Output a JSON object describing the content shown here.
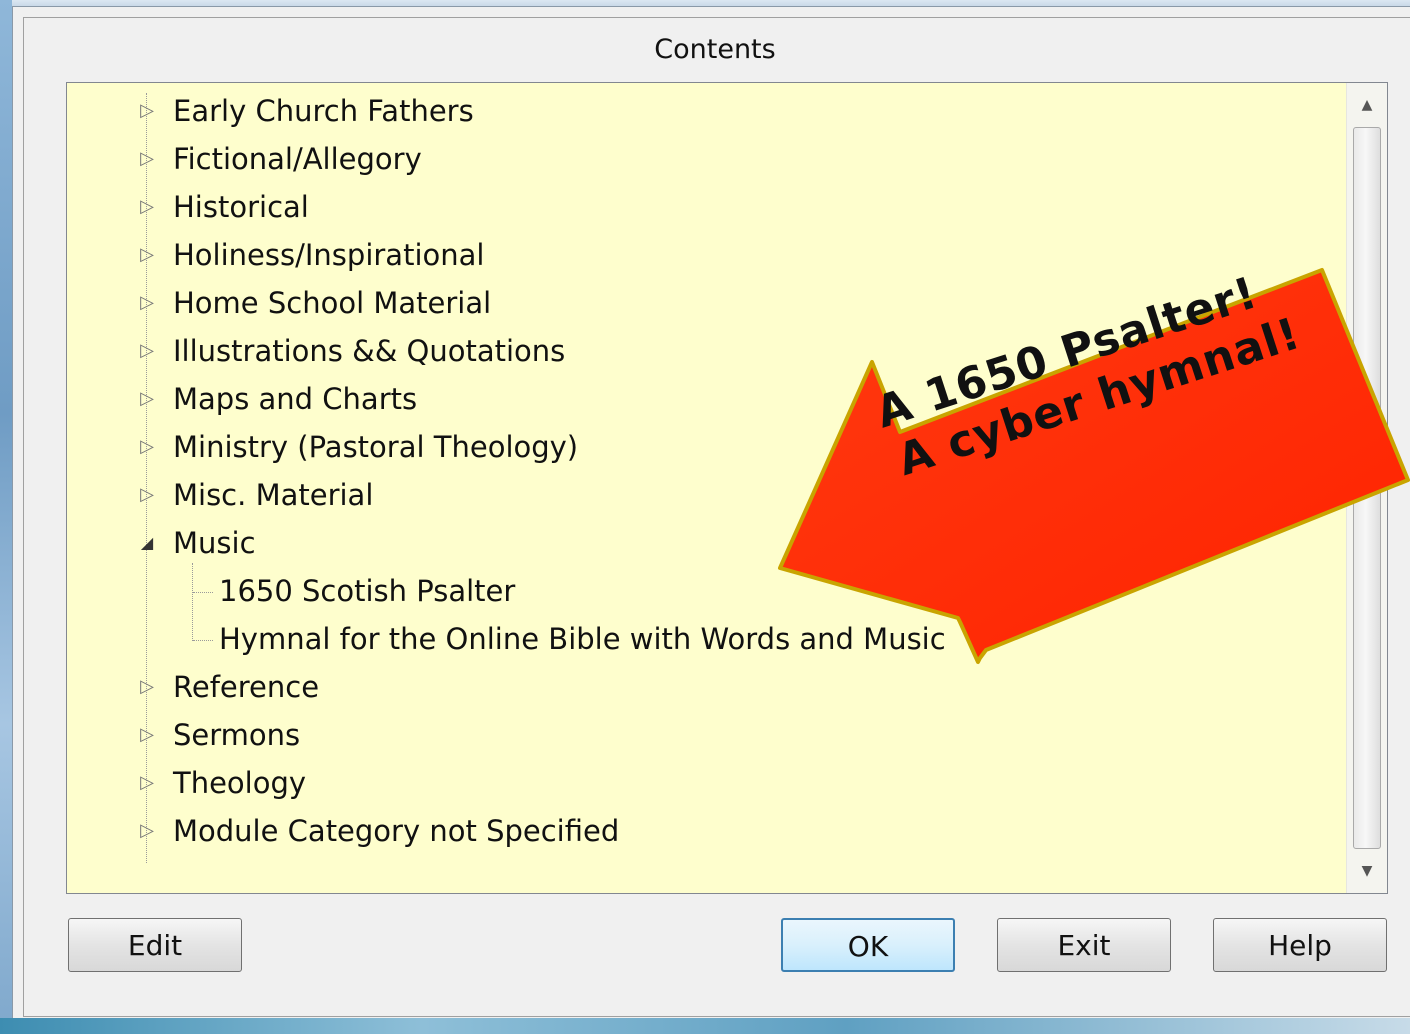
{
  "dialog": {
    "title": "Contents"
  },
  "tree": {
    "items": [
      {
        "label": "Early Church Fathers",
        "state": "collapsed"
      },
      {
        "label": "Fictional/Allegory",
        "state": "collapsed"
      },
      {
        "label": "Historical",
        "state": "collapsed"
      },
      {
        "label": "Holiness/Inspirational",
        "state": "collapsed"
      },
      {
        "label": "Home School Material",
        "state": "collapsed"
      },
      {
        "label": "Illustrations && Quotations",
        "state": "collapsed"
      },
      {
        "label": "Maps and Charts",
        "state": "collapsed"
      },
      {
        "label": "Ministry (Pastoral Theology)",
        "state": "collapsed"
      },
      {
        "label": "Misc. Material",
        "state": "collapsed"
      },
      {
        "label": "Music",
        "state": "expanded"
      },
      {
        "label": "1650 Scotish Psalter",
        "state": "leaf"
      },
      {
        "label": "Hymnal for the Online Bible with Words and Music",
        "state": "leaf"
      },
      {
        "label": "Reference",
        "state": "collapsed"
      },
      {
        "label": "Sermons",
        "state": "collapsed"
      },
      {
        "label": "Theology",
        "state": "collapsed"
      },
      {
        "label": "Module Category not Specified",
        "state": "collapsed"
      }
    ]
  },
  "buttons": {
    "edit": "Edit",
    "ok": "OK",
    "exit": "Exit",
    "help": "Help"
  },
  "callout": {
    "line1": "A 1650 Psalter!",
    "line2": "A cyber hymnal!",
    "fill_color": "#ff2a00",
    "border_color": "#c8a000"
  },
  "colors": {
    "tree_background": "#fefecd",
    "default_button_border": "#3c7fb1"
  },
  "icons": {
    "collapsed": "triangle-right-icon",
    "expanded": "triangle-down-icon",
    "scroll_up": "arrow-up-icon",
    "scroll_down": "arrow-down-icon"
  }
}
